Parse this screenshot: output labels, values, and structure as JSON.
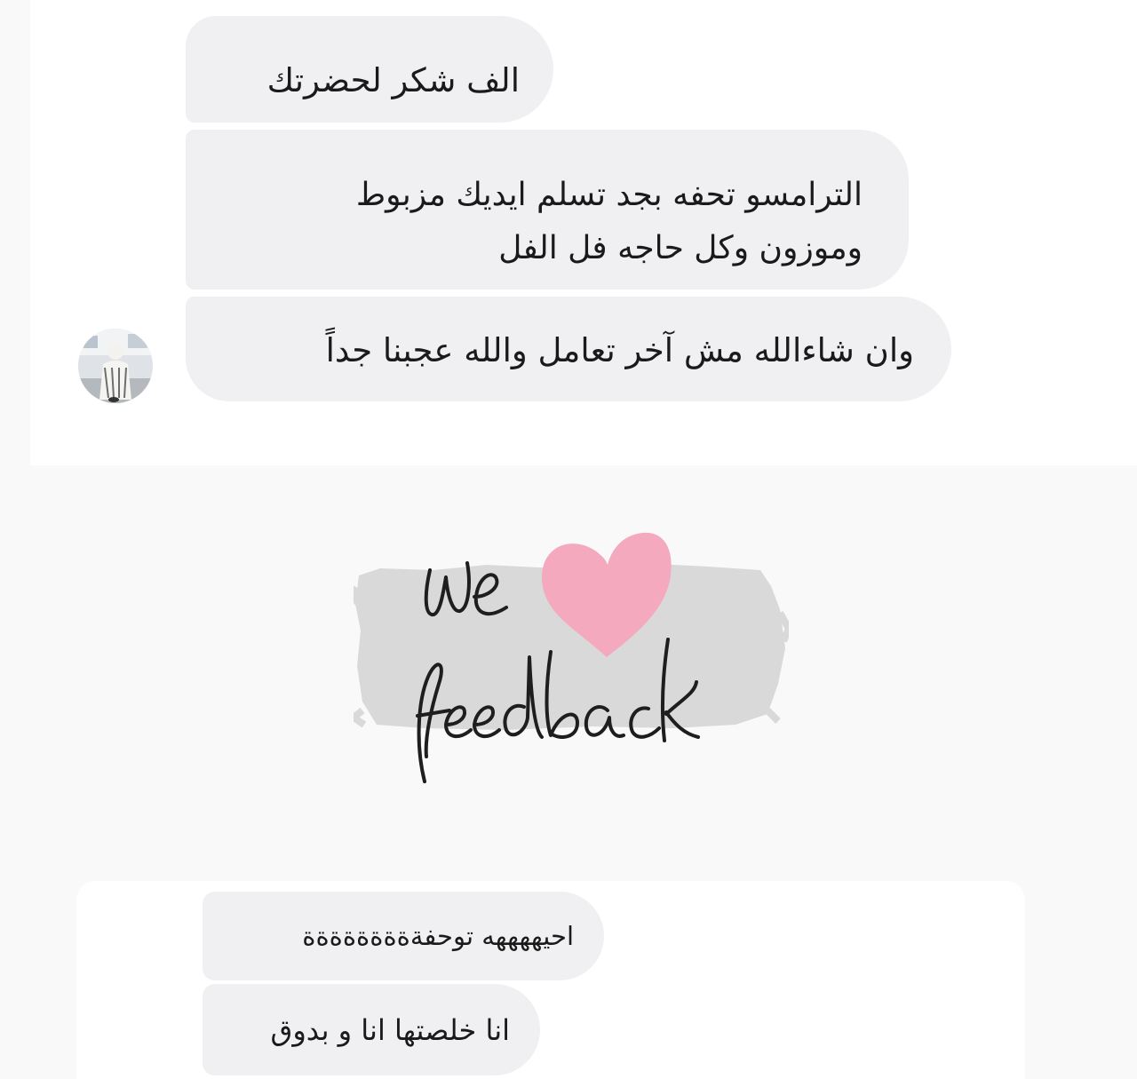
{
  "conversation_top": {
    "messages": [
      {
        "text": "الف شكر لحضرتك"
      },
      {
        "line1": "الترامسو تحفه بجد تسلم ايديك مزبوط",
        "line2": "وموزون وكل حاجه فل الفل"
      },
      {
        "text": "وان شاءالله مش آخر تعامل والله عجبنا جداً"
      }
    ]
  },
  "logo": {
    "word1": "we",
    "word2": "feedback",
    "icon": "heart-icon",
    "heart_color": "#f4a9be",
    "brush_color": "#d9d9da"
  },
  "conversation_bottom": {
    "messages": [
      {
        "text": "احيههههه توحفةةةةةةةةة"
      },
      {
        "text": "انا خلصتها انا و بدوق"
      }
    ]
  },
  "colors": {
    "bubble": "#f0f0f2",
    "text": "#1a1a1a",
    "page": "#f9f9fa"
  }
}
